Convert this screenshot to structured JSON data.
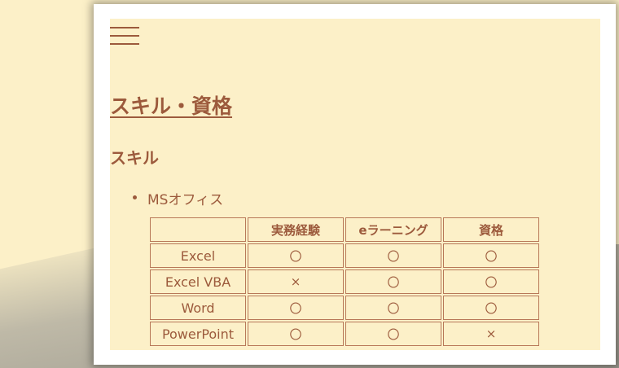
{
  "header": {
    "menu_icon": "hamburger-menu-icon"
  },
  "page_title": "スキル・資格",
  "section_title": "スキル",
  "list": {
    "item_label": "MSオフィス"
  },
  "table": {
    "headers": [
      "",
      "実務経験",
      "eラーニング",
      "資格"
    ],
    "rows": [
      [
        "Excel",
        "〇",
        "〇",
        "〇"
      ],
      [
        "Excel VBA",
        "×",
        "〇",
        "〇"
      ],
      [
        "Word",
        "〇",
        "〇",
        "〇"
      ],
      [
        "PowerPoint",
        "〇",
        "〇",
        "×"
      ]
    ]
  },
  "colors": {
    "background": "#fcf0c8",
    "text": "#9c5a3c",
    "border": "#b87858"
  }
}
